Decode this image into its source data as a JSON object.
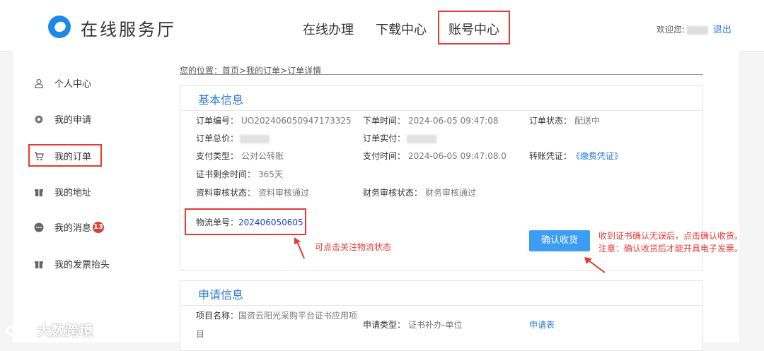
{
  "header": {
    "logo_text": "在线服务厅",
    "nav": [
      "在线办理",
      "下载中心",
      "账号中心"
    ],
    "welcome": "欢迎您:",
    "logout": "退出"
  },
  "sidebar": {
    "items": [
      {
        "label": "个人中心",
        "icon": "user-icon"
      },
      {
        "label": "我的申请",
        "icon": "settings-icon"
      },
      {
        "label": "我的订单",
        "icon": "cart-icon"
      },
      {
        "label": "我的地址",
        "icon": "gift-icon"
      },
      {
        "label": "我的消息",
        "icon": "chat-icon",
        "badge": "13"
      },
      {
        "label": "我的发票抬头",
        "icon": "gift-icon"
      }
    ]
  },
  "breadcrumb": "您的位置：首页>我的订单>订单详情",
  "basic_info": {
    "title": "基本信息",
    "order_no_label": "订单编号：",
    "order_no": "UO202406050947173325",
    "order_time_label": "下单时间：",
    "order_time": "2024-06-05 09:47:08",
    "order_status_label": "订单状态：",
    "order_status": "配送中",
    "total_label": "订单总价：",
    "paid_label": "订单实付：",
    "pay_type_label": "支付类型：",
    "pay_type": "公对公转账",
    "pay_time_label": "支付时间：",
    "pay_time": "2024-06-05 09:47:08.0",
    "voucher_label": "转账凭证：",
    "voucher_link": "《缴费凭证》",
    "cert_remain_label": "证书剩余时间：",
    "cert_remain": "365天",
    "doc_review_label": "资料审核状态：",
    "doc_review": "资料审核通过",
    "fin_review_label": "财务审核状态：",
    "fin_review": "财务审核通过",
    "logistics_label": "物流单号：",
    "logistics_no": "202406050605",
    "confirm_button": "确认收货"
  },
  "annotations": {
    "logistics_tip": "可点击关注物流状态",
    "confirm_tip_1": "收到证书确认无误后，点击确认收货。",
    "confirm_tip_2": "注意：确认收货后才能开具电子发票。"
  },
  "apply_info": {
    "title": "申请信息",
    "project_label": "项目名称：",
    "project_name_1": "国资云阳光采购平台证书应用项",
    "project_name_2": "目",
    "apply_type_label": "申请类型：",
    "apply_type": "证书补办-单位",
    "apply_form_link": "申请表"
  },
  "watermark": "大数跨境",
  "colors": {
    "accent": "#2b7bd6",
    "highlight": "#e53935",
    "button": "#3d9df5"
  }
}
